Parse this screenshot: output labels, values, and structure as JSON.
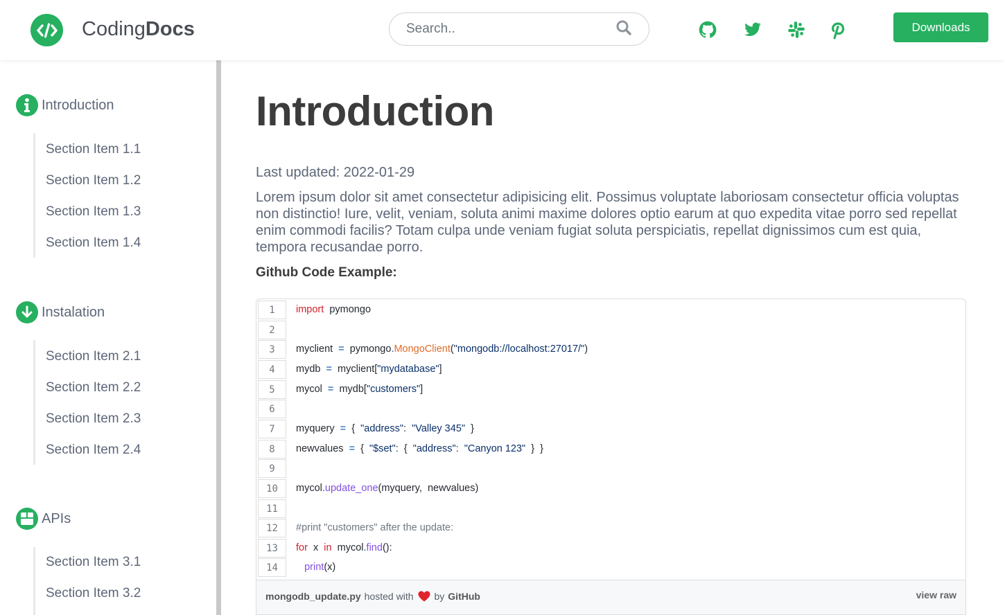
{
  "header": {
    "brand_light": "Coding",
    "brand_bold": "Docs",
    "search_placeholder": "Search..",
    "downloads_label": "Downloads"
  },
  "sidebar": {
    "sections": [
      {
        "title": "Introduction",
        "icon": "info-icon",
        "items": [
          "Section Item 1.1",
          "Section Item 1.2",
          "Section Item 1.3",
          "Section Item 1.4"
        ]
      },
      {
        "title": "Instalation",
        "icon": "arrow-down-icon",
        "items": [
          "Section Item 2.1",
          "Section Item 2.2",
          "Section Item 2.3",
          "Section Item 2.4"
        ]
      },
      {
        "title": "APIs",
        "icon": "box-icon",
        "items": [
          "Section Item 3.1",
          "Section Item 3.2"
        ]
      }
    ]
  },
  "main": {
    "title": "Introduction",
    "last_updated": "Last updated: 2022-01-29",
    "paragraph": "Lorem ipsum dolor sit amet consectetur adipisicing elit. Possimus voluptate laboriosam consectetur officia voluptas non distinctio! Iure, velit, veniam, soluta animi maxime dolores optio earum at quo expedita vitae porro sed repellat enim commodi facilis? Totam culpa unde veniam fugiat soluta perspiciatis, repellat dignissimos cum est quia, tempora recusandae porro.",
    "example_title": "Github Code Example:"
  },
  "gist": {
    "line_numbers": [
      "1",
      "2",
      "3",
      "4",
      "5",
      "6",
      "7",
      "8",
      "9",
      "10",
      "11",
      "12",
      "13",
      "14"
    ],
    "filename": "mongodb_update.py",
    "hosted_with": "hosted with",
    "by": "by",
    "github": "GitHub",
    "view_raw": "view raw"
  },
  "colors": {
    "accent": "#26b060",
    "heart": "#e0222c"
  }
}
